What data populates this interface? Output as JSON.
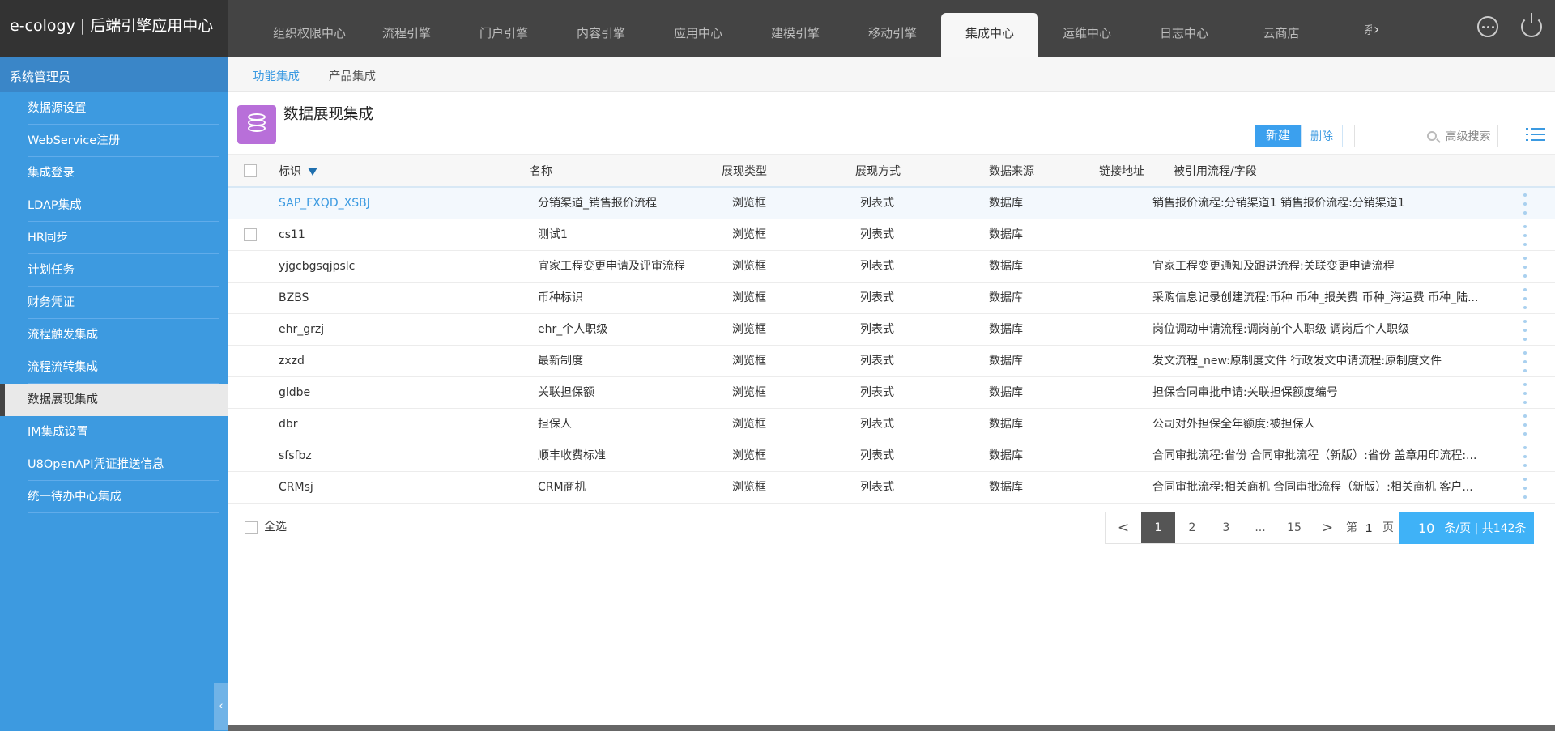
{
  "app": {
    "title": "e-cology | 后端引擎应用中心"
  },
  "top_nav": {
    "tabs": [
      {
        "label": "组织权限中心"
      },
      {
        "label": "流程引擎"
      },
      {
        "label": "门户引擎"
      },
      {
        "label": "内容引擎"
      },
      {
        "label": "应用中心"
      },
      {
        "label": "建模引擎"
      },
      {
        "label": "移动引擎"
      },
      {
        "label": "集成中心",
        "active": true
      },
      {
        "label": "运维中心"
      },
      {
        "label": "日志中心"
      },
      {
        "label": "云商店"
      }
    ],
    "overflow_label": "系",
    "icons": [
      "more-icon",
      "power-icon"
    ]
  },
  "sidebar": {
    "header": "系统管理员",
    "items": [
      {
        "label": "数据源设置"
      },
      {
        "label": "WebService注册"
      },
      {
        "label": "集成登录"
      },
      {
        "label": "LDAP集成"
      },
      {
        "label": "HR同步"
      },
      {
        "label": "计划任务"
      },
      {
        "label": "财务凭证"
      },
      {
        "label": "流程触发集成"
      },
      {
        "label": "流程流转集成"
      },
      {
        "label": "数据展现集成",
        "active": true
      },
      {
        "label": "IM集成设置"
      },
      {
        "label": "U8OpenAPI凭证推送信息"
      },
      {
        "label": "统一待办中心集成"
      }
    ],
    "collapse_icon": "chevron-left-icon"
  },
  "sub_tabs": [
    {
      "label": "功能集成",
      "active": true
    },
    {
      "label": "产品集成"
    }
  ],
  "page": {
    "title": "数据展现集成",
    "icon": "database-icon",
    "new_label": "新建",
    "delete_label": "删除",
    "search_value": "",
    "advanced_search_label": "高级搜索"
  },
  "table": {
    "columns": [
      "标识",
      "名称",
      "展现类型",
      "展现方式",
      "数据来源",
      "链接地址",
      "被引用流程/字段"
    ],
    "rows": [
      {
        "id": "SAP_FXQD_XSBJ",
        "name": "分销渠道_销售报价流程",
        "type": "浏览框",
        "mode": "列表式",
        "source": "数据库",
        "url": "",
        "refs": "销售报价流程:分销渠道1   销售报价流程:分销渠道1",
        "link": true,
        "selected": true,
        "checkbox": false
      },
      {
        "id": "cs11",
        "name": "测试1",
        "type": "浏览框",
        "mode": "列表式",
        "source": "数据库",
        "url": "",
        "refs": "",
        "checkbox": true
      },
      {
        "id": "yjgcbgsqjpslc",
        "name": "宜家工程变更申请及评审流程",
        "type": "浏览框",
        "mode": "列表式",
        "source": "数据库",
        "url": "",
        "refs": "宜家工程变更通知及跟进流程:关联变更申请流程"
      },
      {
        "id": "BZBS",
        "name": "币种标识",
        "type": "浏览框",
        "mode": "列表式",
        "source": "数据库",
        "url": "",
        "refs": "采购信息记录创建流程:币种   币种_报关费   币种_海运费   币种_陆..."
      },
      {
        "id": "ehr_grzj",
        "name": "ehr_个人职级",
        "type": "浏览框",
        "mode": "列表式",
        "source": "数据库",
        "url": "",
        "refs": "岗位调动申请流程:调岗前个人职级   调岗后个人职级"
      },
      {
        "id": "zxzd",
        "name": "最新制度",
        "type": "浏览框",
        "mode": "列表式",
        "source": "数据库",
        "url": "",
        "refs": "发文流程_new:原制度文件   行政发文申请流程:原制度文件"
      },
      {
        "id": "gldbe",
        "name": "关联担保额",
        "type": "浏览框",
        "mode": "列表式",
        "source": "数据库",
        "url": "",
        "refs": "担保合同审批申请:关联担保额度编号"
      },
      {
        "id": "dbr",
        "name": "担保人",
        "type": "浏览框",
        "mode": "列表式",
        "source": "数据库",
        "url": "",
        "refs": "公司对外担保全年额度:被担保人"
      },
      {
        "id": "sfsfbz",
        "name": "顺丰收费标准",
        "type": "浏览框",
        "mode": "列表式",
        "source": "数据库",
        "url": "",
        "refs": "合同审批流程:省份   合同审批流程（新版）:省份   盖章用印流程:..."
      },
      {
        "id": "CRMsj",
        "name": "CRM商机",
        "type": "浏览框",
        "mode": "列表式",
        "source": "数据库",
        "url": "",
        "refs": "合同审批流程:相关商机   合同审批流程（新版）:相关商机   客户..."
      }
    ],
    "select_all_label": "全选"
  },
  "pagination": {
    "prev": "<",
    "pages": [
      "1",
      "2",
      "3",
      "...",
      "15"
    ],
    "current": "1",
    "next": ">",
    "goto_prefix": "第",
    "goto_value": "1",
    "goto_suffix": "页",
    "page_size": "10",
    "page_size_suffix": "条/页 | 共142条"
  },
  "colors": {
    "brand_blue": "#3b9ae1",
    "sidebar_bg": "#3d9ae0",
    "topbar_bg": "#444444",
    "icon_purple": "#b86fd9",
    "pager_blue": "#3fb2f7"
  }
}
